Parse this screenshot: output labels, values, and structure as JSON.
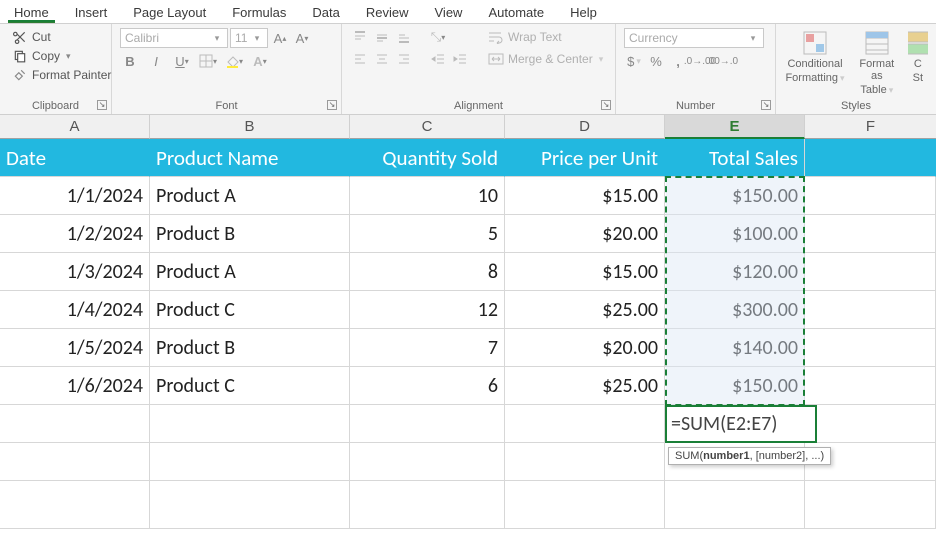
{
  "tabs": [
    "Home",
    "Insert",
    "Page Layout",
    "Formulas",
    "Data",
    "Review",
    "View",
    "Automate",
    "Help"
  ],
  "activeTab": 0,
  "ribbon": {
    "clipboard": {
      "label": "Clipboard",
      "cut": "Cut",
      "copy": "Copy",
      "formatPainter": "Format Painter"
    },
    "font": {
      "label": "Font",
      "name": "Calibri",
      "size": "11",
      "buttons": {
        "increase": "A",
        "decrease": "A"
      }
    },
    "alignment": {
      "label": "Alignment",
      "wrap": "Wrap Text",
      "merge": "Merge & Center"
    },
    "number": {
      "label": "Number",
      "format": "Currency"
    },
    "styles": {
      "label": "Styles",
      "conditional_l1": "Conditional",
      "conditional_l2": "Formatting",
      "table_l1": "Format as",
      "table_l2": "Table",
      "cellstyles_l1": "C",
      "cellstyles_l2": "St"
    }
  },
  "columns": [
    "A",
    "B",
    "C",
    "D",
    "E",
    "F"
  ],
  "headerRow": [
    "Date",
    "Product Name",
    "Quantity Sold",
    "Price per Unit",
    "Total Sales"
  ],
  "rows": [
    {
      "date": "1/1/2024",
      "product": "Product A",
      "qty": "10",
      "price": "$15.00",
      "total": "$150.00"
    },
    {
      "date": "1/2/2024",
      "product": "Product B",
      "qty": "5",
      "price": "$20.00",
      "total": "$100.00"
    },
    {
      "date": "1/3/2024",
      "product": "Product A",
      "qty": "8",
      "price": "$15.00",
      "total": "$120.00"
    },
    {
      "date": "1/4/2024",
      "product": "Product C",
      "qty": "12",
      "price": "$25.00",
      "total": "$300.00"
    },
    {
      "date": "1/5/2024",
      "product": "Product B",
      "qty": "7",
      "price": "$20.00",
      "total": "$140.00"
    },
    {
      "date": "1/6/2024",
      "product": "Product C",
      "qty": "6",
      "price": "$25.00",
      "total": "$150.00"
    }
  ],
  "editCell": {
    "prefix": "=SUM(",
    "ref": "E2:E7",
    "suffix": ")"
  },
  "tooltip": "SUM(number1, [number2], ...)",
  "chart_data": {
    "type": "table",
    "columns": [
      "Date",
      "Product Name",
      "Quantity Sold",
      "Price per Unit",
      "Total Sales"
    ],
    "data": [
      [
        "1/1/2024",
        "Product A",
        10,
        15.0,
        150.0
      ],
      [
        "1/2/2024",
        "Product B",
        5,
        20.0,
        100.0
      ],
      [
        "1/3/2024",
        "Product A",
        8,
        15.0,
        120.0
      ],
      [
        "1/4/2024",
        "Product C",
        12,
        25.0,
        300.0
      ],
      [
        "1/5/2024",
        "Product B",
        7,
        20.0,
        140.0
      ],
      [
        "1/6/2024",
        "Product C",
        6,
        25.0,
        150.0
      ]
    ]
  }
}
